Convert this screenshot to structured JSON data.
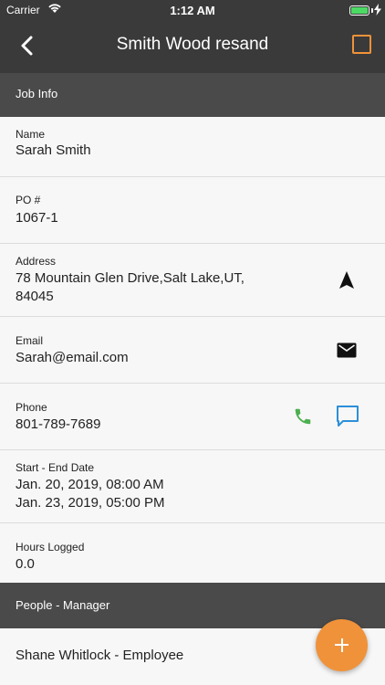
{
  "status_bar": {
    "carrier": "Carrier",
    "time": "1:12 AM",
    "battery_percent": 100,
    "battery_color": "#4cd964"
  },
  "nav": {
    "title": "Smith Wood resand",
    "back_icon": "chevron-left-icon",
    "checkbox_icon": "checkbox-icon",
    "accent_color": "#f0923a"
  },
  "job_info": {
    "header": "Job Info",
    "name": {
      "label": "Name",
      "value": "Sarah Smith"
    },
    "po": {
      "label": "PO #",
      "value": "1067-1"
    },
    "address": {
      "label": "Address",
      "line1": "78 Mountain Glen Drive,Salt Lake,UT,",
      "line2": "84045",
      "icon": "navigation-arrow-icon"
    },
    "email": {
      "label": "Email",
      "value": "Sarah@email.com",
      "icon": "mail-icon"
    },
    "phone": {
      "label": "Phone",
      "value": "801-789-7689",
      "call_icon": "phone-icon",
      "message_icon": "message-icon",
      "call_color": "#4caf50",
      "message_color": "#2e8fd8"
    },
    "dates": {
      "label": "Start - End Date",
      "start": "Jan. 20, 2019, 08:00 AM",
      "end": "Jan. 23, 2019, 05:00 PM"
    },
    "hours": {
      "label": "Hours Logged",
      "value": "0.0"
    }
  },
  "people": {
    "header": "People - Manager",
    "items": [
      {
        "name": "Shane Whitlock - Employee"
      }
    ]
  },
  "fab": {
    "icon": "plus-icon"
  }
}
